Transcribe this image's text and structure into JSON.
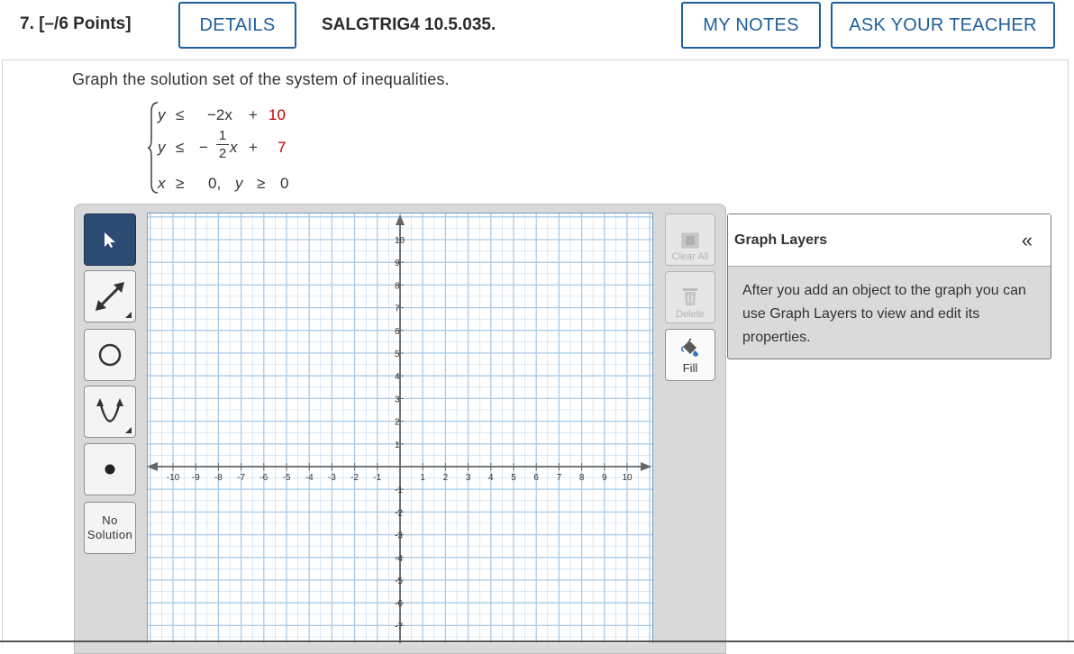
{
  "header": {
    "question_number": "7.",
    "points": "[–/6 Points]",
    "details_label": "DETAILS",
    "problem_code": "SALGTRIG4 10.5.035.",
    "my_notes_label": "MY NOTES",
    "ask_teacher_label": "ASK YOUR TEACHER",
    "accent_color": "#1f5e9c"
  },
  "prompt": "Graph the solution set of the system of inequalities.",
  "system": {
    "row1": {
      "var": "y",
      "op": "≤",
      "expr": "−2x",
      "plus": "+",
      "const": "10"
    },
    "row2": {
      "var": "y",
      "op": "≤",
      "sign": "−",
      "frac_num": "1",
      "frac_den": "2",
      "x": "x",
      "plus": "+",
      "const": "7"
    },
    "row3": {
      "var": "x",
      "op": "≥",
      "val": "0,",
      "var2": "y",
      "op2": "≥",
      "val2": "0"
    },
    "const_color": "#c00000"
  },
  "tools": {
    "pointer": "pointer-tool",
    "line": "line-tool",
    "circle": "circle-tool",
    "parabola": "parabola-tool",
    "point": "point-tool",
    "no_solution_line1": "No",
    "no_solution_line2": "Solution"
  },
  "grid": {
    "x_ticks": [
      "-10",
      "-9",
      "-8",
      "-7",
      "-6",
      "-5",
      "-4",
      "-3",
      "-2",
      "-1",
      "1",
      "2",
      "3",
      "4",
      "5",
      "6",
      "7",
      "8",
      "9",
      "10"
    ],
    "y_ticks": [
      "10",
      "9",
      "8",
      "7",
      "6",
      "5",
      "4",
      "3",
      "2",
      "1",
      "-1",
      "-2",
      "-3",
      "-4",
      "-5",
      "-6",
      "-7"
    ],
    "grid_color": "#a9cbe7",
    "axis_color": "#666666"
  },
  "right_tools": {
    "clear_all_label": "Clear All",
    "delete_label": "Delete",
    "fill_label": "Fill"
  },
  "layers": {
    "title": "Graph Layers",
    "collapse_glyph": "«",
    "description": "After you add an object to the graph you can use Graph Layers to view and edit its properties."
  }
}
